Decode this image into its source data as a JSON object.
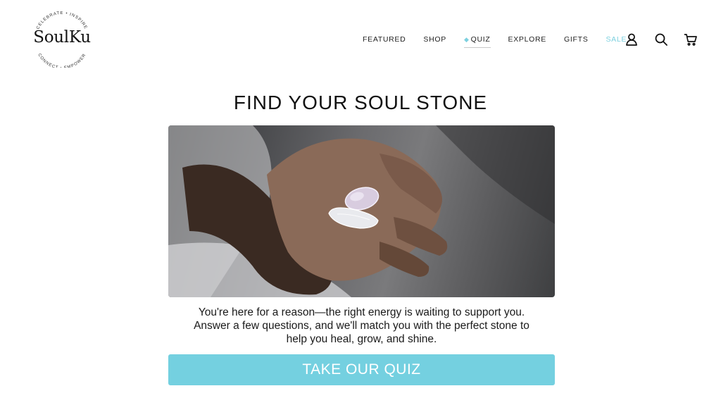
{
  "brand": {
    "name": "SoulKu",
    "ring_top": "CELEBRATE • INSPIRE",
    "ring_bottom": "CONNECT • EMPOWER"
  },
  "nav": {
    "featured": "FEATURED",
    "shop": "SHOP",
    "quiz": "QUIZ",
    "explore": "EXPLORE",
    "gifts": "GIFTS",
    "sale": "SALE"
  },
  "icons": {
    "quiz_gem": "gem-icon",
    "account": "account-icon",
    "search": "search-icon",
    "cart": "cart-icon"
  },
  "main": {
    "title": "FIND YOUR SOUL STONE",
    "description_lines": [
      "You're here for a reason—the right energy is waiting to support you.",
      "Answer a few questions, and we'll match you with the perfect stone to",
      "help you heal, grow, and shine."
    ],
    "cta": "TAKE OUR QUIZ"
  },
  "colors": {
    "accent": "#74d0e0",
    "sale": "#7cd0df",
    "text": "#1a1a1a"
  }
}
